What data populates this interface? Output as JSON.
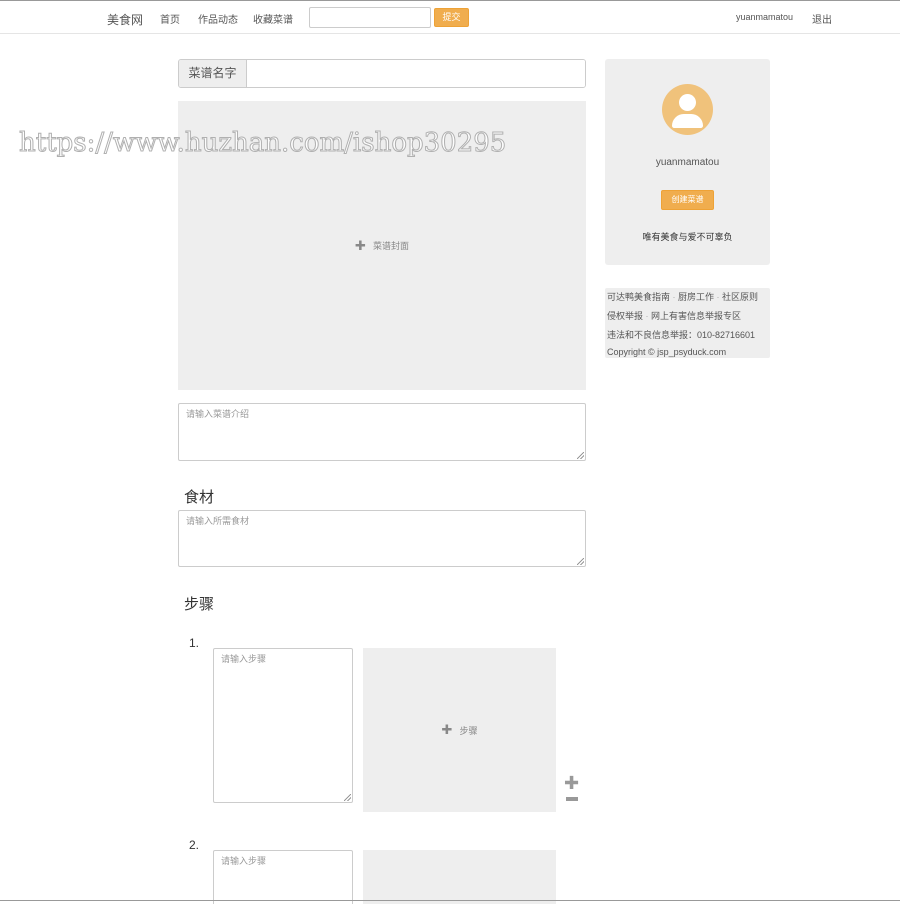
{
  "nav": {
    "brand": "美食网",
    "links": [
      "首页",
      "作品动态",
      "收藏菜谱"
    ],
    "search_value": "",
    "submit_label": "提交",
    "username": "yuanmamatou",
    "logout_label": "退出"
  },
  "recipe_form": {
    "name_label": "菜谱名字",
    "name_value": "",
    "cover_label": "菜谱封面",
    "intro_placeholder": "请输入菜谱介绍",
    "ingredients_heading": "食材",
    "ingredients_placeholder": "请输入所需食材",
    "steps_heading": "步骤",
    "steps": [
      {
        "number": "1.",
        "placeholder": "请输入步骤",
        "photo_label": "步骤"
      },
      {
        "number": "2.",
        "placeholder": "请输入步骤",
        "photo_label": ""
      }
    ],
    "add_step_icon": "plus-icon",
    "remove_step_icon": "minus-icon"
  },
  "watermark": "https://www.huzhan.com/ishop30295",
  "profile": {
    "username": "yuanmamatou",
    "create_label": "创建菜谱",
    "tagline": "唯有美食与爱不可辜负",
    "avatar_icon": "user-avatar-icon"
  },
  "footer": {
    "links": [
      "可达鸭美食指南",
      "厨房工作",
      "社区原则",
      "侵权举报",
      "网上有害信息举报专区"
    ],
    "report_line": "违法和不良信息举报：010-82716601",
    "copyright": "Copyright © jsp_psyduck.com"
  },
  "colors": {
    "accent": "#f0ad4e",
    "avatar": "#f0c27b",
    "panel": "#eeeeee"
  }
}
